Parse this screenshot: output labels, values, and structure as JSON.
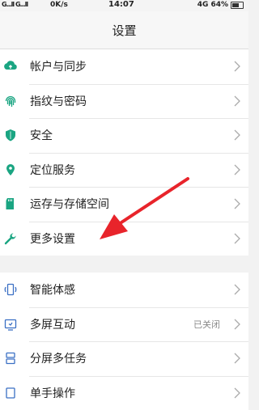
{
  "status_bar": {
    "signal": "G...ll G...ll",
    "speed": "0K/s",
    "time": "14:07",
    "network": "4G",
    "battery": "64%"
  },
  "title": "设置",
  "group1": [
    {
      "label": "帐户与同步",
      "icon": "cloud-sync-icon"
    },
    {
      "label": "指纹与密码",
      "icon": "fingerprint-icon"
    },
    {
      "label": "安全",
      "icon": "shield-icon"
    },
    {
      "label": "定位服务",
      "icon": "location-pin-icon"
    },
    {
      "label": "运存与存储空间",
      "icon": "sd-card-icon"
    },
    {
      "label": "更多设置",
      "icon": "wrench-icon"
    }
  ],
  "group2": [
    {
      "label": "智能体感",
      "icon": "phone-motion-icon",
      "status": ""
    },
    {
      "label": "多屏互动",
      "icon": "screen-cast-icon",
      "status": "已关闭"
    },
    {
      "label": "分屏多任务",
      "icon": "split-screen-icon",
      "status": ""
    },
    {
      "label": "单手操作",
      "icon": "one-hand-icon",
      "status": ""
    }
  ],
  "colors": {
    "accent": "#1aa582",
    "arrow": "#e8242b"
  }
}
